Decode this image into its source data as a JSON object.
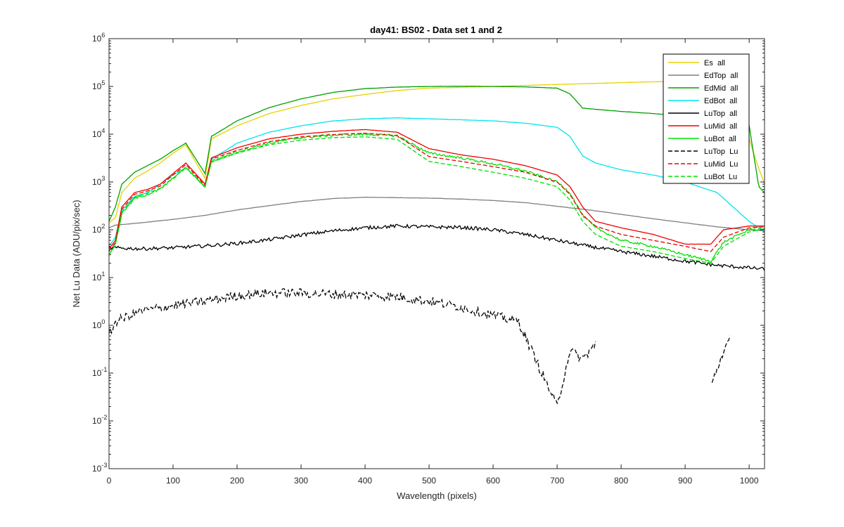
{
  "chart_data": {
    "type": "line",
    "title": "day41: BS02 - Data set 1 and 2",
    "xlabel": "Wavelength (pixels)",
    "ylabel": "Net Lu Data (ADU/pix/sec)",
    "xlim": [
      0,
      1024
    ],
    "ylim_log10": [
      -3,
      6
    ],
    "yscale": "log",
    "grid": false,
    "legend_position": "top-right",
    "x_ticks": [
      "0",
      "100",
      "200",
      "300",
      "400",
      "500",
      "600",
      "700",
      "800",
      "900",
      "1000"
    ],
    "y_ticks": [
      {
        "base": "10",
        "exp": "-3"
      },
      {
        "base": "10",
        "exp": "-2"
      },
      {
        "base": "10",
        "exp": "-1"
      },
      {
        "base": "10",
        "exp": "0"
      },
      {
        "base": "10",
        "exp": "1"
      },
      {
        "base": "10",
        "exp": "2"
      },
      {
        "base": "10",
        "exp": "3"
      },
      {
        "base": "10",
        "exp": "4"
      },
      {
        "base": "10",
        "exp": "5"
      },
      {
        "base": "10",
        "exp": "6"
      }
    ],
    "series": [
      {
        "name": "Es  all",
        "color": "#E6D200",
        "dash": "solid",
        "noise": 0.01,
        "x": [
          0,
          10,
          20,
          40,
          60,
          80,
          100,
          120,
          150,
          160,
          200,
          250,
          300,
          350,
          400,
          450,
          500,
          600,
          650,
          700,
          750,
          800,
          850,
          900,
          950,
          1000,
          1010,
          1024
        ],
        "y": [
          140,
          180,
          600,
          1200,
          1700,
          2500,
          4000,
          6000,
          1200,
          8000,
          15000,
          27000,
          40000,
          55000,
          68000,
          82000,
          92000,
          100000,
          105000,
          110000,
          115000,
          120000,
          125000,
          128000,
          125000,
          8000,
          3000,
          900
        ]
      },
      {
        "name": "EdTop  all",
        "color": "#7F7F7F",
        "dash": "solid",
        "noise": 0.015,
        "x": [
          0,
          10,
          50,
          100,
          150,
          200,
          250,
          300,
          350,
          400,
          450,
          500,
          550,
          600,
          650,
          700,
          750,
          800,
          850,
          900,
          950,
          1000,
          1024
        ],
        "y": [
          110,
          125,
          140,
          165,
          200,
          260,
          320,
          390,
          450,
          480,
          470,
          460,
          440,
          410,
          370,
          310,
          260,
          210,
          170,
          140,
          115,
          100,
          95
        ]
      },
      {
        "name": "EdMid  all",
        "color": "#00A000",
        "dash": "solid",
        "noise": 0.015,
        "x": [
          0,
          10,
          20,
          40,
          60,
          80,
          100,
          120,
          150,
          160,
          200,
          250,
          300,
          350,
          400,
          450,
          500,
          550,
          600,
          650,
          700,
          720,
          740,
          800,
          850,
          900,
          950,
          1000,
          1015,
          1024
        ],
        "y": [
          150,
          300,
          900,
          1600,
          2200,
          3000,
          4500,
          6500,
          1500,
          9000,
          19000,
          36000,
          55000,
          75000,
          90000,
          97000,
          100000,
          101000,
          100000,
          98000,
          92000,
          70000,
          35000,
          30000,
          27000,
          24000,
          20000,
          15000,
          800,
          600
        ]
      },
      {
        "name": "EdBot  all",
        "color": "#00E5EE",
        "dash": "solid",
        "noise": 0.015,
        "x": [
          0,
          10,
          20,
          40,
          60,
          80,
          100,
          120,
          150,
          160,
          200,
          250,
          300,
          350,
          400,
          450,
          500,
          550,
          600,
          650,
          700,
          720,
          740,
          760,
          800,
          850,
          900,
          950,
          1000,
          1024
        ],
        "y": [
          45,
          70,
          250,
          500,
          600,
          900,
          1400,
          2000,
          800,
          3000,
          6500,
          11000,
          15000,
          19000,
          21000,
          22000,
          21000,
          20000,
          19000,
          17000,
          14000,
          9000,
          3500,
          2500,
          1800,
          1400,
          1000,
          600,
          150,
          90
        ]
      },
      {
        "name": "LuTop  all",
        "color": "#000000",
        "dash": "solid",
        "noise": 0.06,
        "x": [
          0,
          50,
          100,
          150,
          200,
          250,
          300,
          350,
          400,
          450,
          500,
          550,
          600,
          650,
          700,
          750,
          800,
          850,
          900,
          950,
          1000,
          1024
        ],
        "y": [
          42,
          40,
          42,
          46,
          52,
          62,
          78,
          95,
          110,
          120,
          115,
          112,
          100,
          80,
          60,
          45,
          35,
          28,
          22,
          18,
          16,
          15
        ]
      },
      {
        "name": "LuMid  all",
        "color": "#EE0000",
        "dash": "solid",
        "noise": 0.012,
        "x": [
          0,
          10,
          20,
          40,
          60,
          80,
          100,
          120,
          150,
          160,
          200,
          250,
          300,
          350,
          400,
          450,
          500,
          550,
          600,
          650,
          700,
          720,
          740,
          760,
          800,
          850,
          900,
          940,
          960,
          1000,
          1024
        ],
        "y": [
          40,
          60,
          300,
          600,
          700,
          900,
          1500,
          2500,
          900,
          3200,
          5200,
          8000,
          10000,
          11500,
          12500,
          11000,
          5000,
          3700,
          3000,
          2200,
          1400,
          800,
          300,
          150,
          110,
          80,
          50,
          50,
          100,
          120,
          120
        ]
      },
      {
        "name": "LuBot  all",
        "color": "#00E000",
        "dash": "solid",
        "noise": 0.05,
        "x": [
          0,
          10,
          20,
          40,
          60,
          80,
          100,
          120,
          150,
          160,
          200,
          250,
          300,
          350,
          400,
          450,
          500,
          550,
          600,
          650,
          700,
          720,
          740,
          760,
          800,
          850,
          900,
          940,
          960,
          1000,
          1024
        ],
        "y": [
          30,
          50,
          220,
          450,
          550,
          700,
          1200,
          2000,
          800,
          2700,
          4300,
          6500,
          8500,
          9600,
          10000,
          9300,
          4000,
          3200,
          2400,
          1700,
          1000,
          600,
          200,
          110,
          60,
          45,
          30,
          22,
          55,
          100,
          105
        ]
      },
      {
        "name": "LuTop  Lu",
        "color": "#000000",
        "dash": "dashed",
        "noise": 0.1,
        "x": [
          0,
          10,
          50,
          100,
          150,
          200,
          250,
          300,
          350,
          400,
          450,
          500,
          550,
          600,
          640,
          660,
          700,
          720,
          740,
          760,
          800,
          850,
          900,
          940,
          960,
          970,
          1024
        ],
        "y": [
          0.6,
          1.2,
          2.0,
          2.6,
          3.2,
          4.2,
          4.8,
          4.7,
          4.5,
          4.3,
          4.0,
          3.2,
          2.4,
          1.6,
          1.2,
          0.3,
          0.02,
          0.3,
          0.2,
          0.4,
          null,
          null,
          null,
          0.05,
          0.3,
          0.5,
          null
        ]
      },
      {
        "name": "LuMid  Lu",
        "color": "#EE0000",
        "dash": "dashed",
        "noise": 0.01,
        "x": [
          0,
          10,
          20,
          40,
          60,
          80,
          100,
          120,
          150,
          160,
          200,
          250,
          300,
          350,
          400,
          450,
          500,
          550,
          600,
          650,
          700,
          720,
          740,
          760,
          800,
          850,
          900,
          940,
          960,
          1000,
          1024
        ],
        "y": [
          35,
          55,
          270,
          550,
          650,
          820,
          1400,
          2300,
          850,
          3000,
          4600,
          7000,
          8800,
          9800,
          10500,
          9300,
          3400,
          2700,
          2100,
          1600,
          1000,
          550,
          200,
          120,
          80,
          60,
          45,
          35,
          70,
          110,
          115
        ]
      },
      {
        "name": "LuBot  Lu",
        "color": "#00E000",
        "dash": "dashed",
        "noise": 0.01,
        "x": [
          0,
          10,
          20,
          40,
          60,
          80,
          100,
          120,
          150,
          160,
          200,
          250,
          300,
          350,
          400,
          450,
          500,
          550,
          600,
          650,
          700,
          720,
          740,
          760,
          800,
          850,
          900,
          940,
          960,
          1000,
          1024
        ],
        "y": [
          30,
          48,
          230,
          480,
          580,
          740,
          1200,
          2000,
          780,
          2600,
          4000,
          6000,
          7500,
          8500,
          8800,
          7800,
          2700,
          2100,
          1600,
          1200,
          800,
          420,
          150,
          80,
          45,
          35,
          25,
          20,
          45,
          90,
          105
        ]
      }
    ]
  }
}
